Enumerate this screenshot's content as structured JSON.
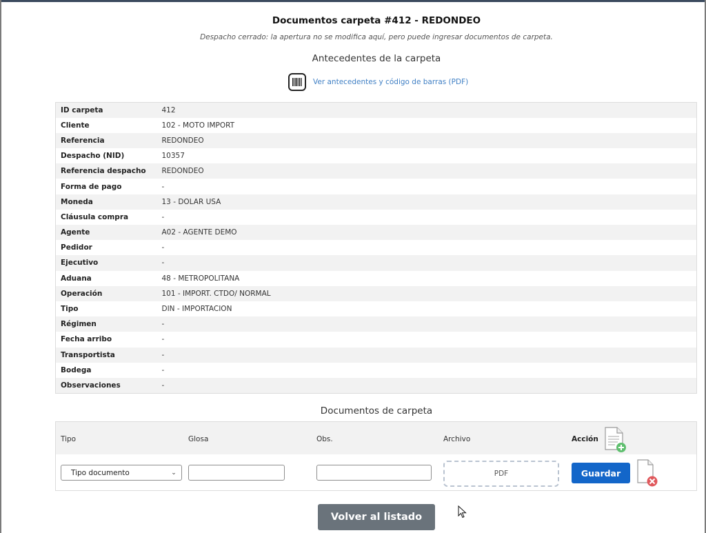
{
  "page": {
    "title": "Documentos carpeta #412 - REDONDEO",
    "subtitle": "Despacho cerrado: la apertura no se modifica aquí, pero puede ingresar documentos de carpeta."
  },
  "antecedentes": {
    "section_title": "Antecedentes de la carpeta",
    "pdf_link_label": "Ver antecedentes y código de barras (PDF)",
    "icon": "barcode-icon",
    "rows": [
      {
        "label": "ID carpeta",
        "value": "412"
      },
      {
        "label": "Cliente",
        "value": "102 - MOTO IMPORT"
      },
      {
        "label": "Referencia",
        "value": "REDONDEO"
      },
      {
        "label": "Despacho (NID)",
        "value": "10357"
      },
      {
        "label": "Referencia despacho",
        "value": "REDONDEO"
      },
      {
        "label": "Forma de pago",
        "value": "-"
      },
      {
        "label": "Moneda",
        "value": "13 - DOLAR USA"
      },
      {
        "label": "Cláusula compra",
        "value": "-"
      },
      {
        "label": "Agente",
        "value": "A02 - AGENTE DEMO"
      },
      {
        "label": "Pedidor",
        "value": "-"
      },
      {
        "label": "Ejecutivo",
        "value": "-"
      },
      {
        "label": "Aduana",
        "value": "48 - METROPOLITANA"
      },
      {
        "label": "Operación",
        "value": "101 - IMPORT. CTDO/ NORMAL"
      },
      {
        "label": "Tipo",
        "value": "DIN - IMPORTACION"
      },
      {
        "label": "Régimen",
        "value": "-"
      },
      {
        "label": "Fecha arribo",
        "value": "-"
      },
      {
        "label": "Transportista",
        "value": "-"
      },
      {
        "label": "Bodega",
        "value": "-"
      },
      {
        "label": "Observaciones",
        "value": "-"
      }
    ]
  },
  "documentos": {
    "section_title": "Documentos de carpeta",
    "headers": {
      "tipo": "Tipo",
      "glosa": "Glosa",
      "obs": "Obs.",
      "archivo": "Archivo",
      "accion": "Acción"
    },
    "tipo_select_value": "Tipo documento",
    "glosa_value": "",
    "obs_value": "",
    "archivo_placeholder": "PDF",
    "save_label": "Guardar",
    "add_icon": "add-document-icon",
    "delete_icon": "delete-document-icon"
  },
  "footer": {
    "back_label": "Volver al listado"
  },
  "colors": {
    "primary": "#1366c9",
    "secondary": "#6a737b",
    "link": "#3f7fc4",
    "add_green": "#5fbf6f",
    "delete_red": "#e0585c"
  }
}
